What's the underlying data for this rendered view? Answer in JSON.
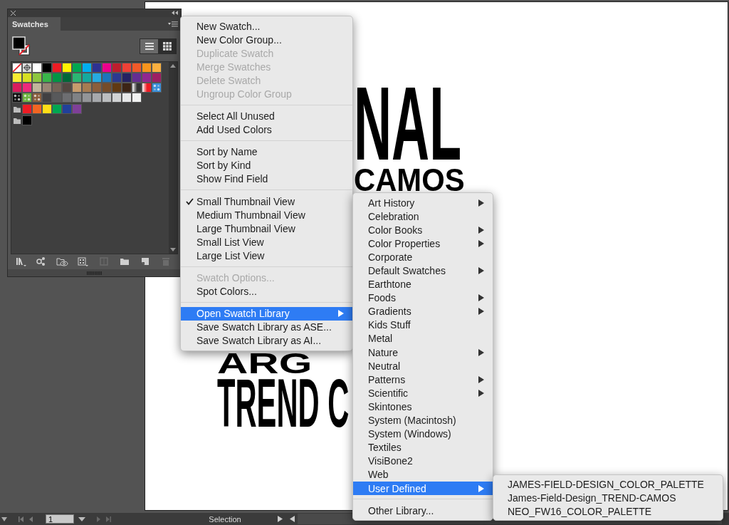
{
  "panel": {
    "title": "Swatches",
    "view_buttons": [
      {
        "kind": "list",
        "selected": false
      },
      {
        "kind": "grid",
        "selected": true
      }
    ],
    "swatch_rows": [
      {
        "items": [
          {
            "kind": "none"
          },
          {
            "kind": "registration"
          },
          {
            "kind": "color",
            "color": "#ffffff"
          },
          {
            "kind": "color",
            "color": "#000000"
          },
          {
            "kind": "color",
            "color": "#ed1c24"
          },
          {
            "kind": "color",
            "color": "#fff200"
          },
          {
            "kind": "color",
            "color": "#00a651"
          },
          {
            "kind": "color",
            "color": "#00aeef"
          },
          {
            "kind": "color",
            "color": "#2e3192"
          },
          {
            "kind": "color",
            "color": "#ec008c"
          },
          {
            "kind": "color",
            "color": "#be1e2d"
          },
          {
            "kind": "color",
            "color": "#ef4136"
          },
          {
            "kind": "color",
            "color": "#f15a29"
          },
          {
            "kind": "color",
            "color": "#f7941d"
          },
          {
            "kind": "color",
            "color": "#fbb040"
          }
        ]
      },
      {
        "items": [
          {
            "kind": "color",
            "color": "#f9ed32"
          },
          {
            "kind": "color",
            "color": "#d7df23"
          },
          {
            "kind": "color",
            "color": "#8dc63f"
          },
          {
            "kind": "color",
            "color": "#39b54a"
          },
          {
            "kind": "color",
            "color": "#009444"
          },
          {
            "kind": "color",
            "color": "#006838"
          },
          {
            "kind": "color",
            "color": "#2bb673"
          },
          {
            "kind": "color",
            "color": "#15a99e"
          },
          {
            "kind": "color",
            "color": "#27aae1"
          },
          {
            "kind": "color",
            "color": "#1c75bc"
          },
          {
            "kind": "color",
            "color": "#2b3990"
          },
          {
            "kind": "color",
            "color": "#262262"
          },
          {
            "kind": "color",
            "color": "#662d91"
          },
          {
            "kind": "color",
            "color": "#92278f"
          },
          {
            "kind": "color",
            "color": "#9e1f63"
          }
        ]
      },
      {
        "items": [
          {
            "kind": "color",
            "color": "#da1c5c"
          },
          {
            "kind": "color",
            "color": "#ee2a7b"
          },
          {
            "kind": "color",
            "color": "#c2b59b"
          },
          {
            "kind": "color",
            "color": "#998675"
          },
          {
            "kind": "color",
            "color": "#736357"
          },
          {
            "kind": "color",
            "color": "#534741"
          },
          {
            "kind": "color",
            "color": "#c69c6d"
          },
          {
            "kind": "color",
            "color": "#a67c52"
          },
          {
            "kind": "color",
            "color": "#8b5e3c"
          },
          {
            "kind": "color",
            "color": "#754c29"
          },
          {
            "kind": "color",
            "color": "#603913"
          },
          {
            "kind": "color",
            "color": "#3c2415"
          },
          {
            "kind": "gradient",
            "color": "#333333"
          },
          {
            "kind": "gradient",
            "color": "#ed1c24"
          },
          {
            "kind": "pattern",
            "color": "#3a8fd8"
          }
        ]
      },
      {
        "items": [
          {
            "kind": "pattern",
            "color": "#111111"
          },
          {
            "kind": "pattern",
            "color": "#6cb33f"
          },
          {
            "kind": "pattern",
            "color": "#8b5e3c"
          },
          {
            "kind": "color",
            "color": "#414042"
          },
          {
            "kind": "color",
            "color": "#58595b"
          },
          {
            "kind": "color",
            "color": "#6d6e71"
          },
          {
            "kind": "color",
            "color": "#808285"
          },
          {
            "kind": "color",
            "color": "#939598"
          },
          {
            "kind": "color",
            "color": "#a7a9ac"
          },
          {
            "kind": "color",
            "color": "#bcbec0"
          },
          {
            "kind": "color",
            "color": "#d1d3d4"
          },
          {
            "kind": "color",
            "color": "#e6e7e8"
          },
          {
            "kind": "color",
            "color": "#f1f2f2"
          }
        ]
      },
      {
        "items": [
          {
            "kind": "folder"
          },
          {
            "kind": "color",
            "color": "#ed1c24"
          },
          {
            "kind": "color",
            "color": "#f26522"
          },
          {
            "kind": "color",
            "color": "#ffde17"
          },
          {
            "kind": "color",
            "color": "#00a651"
          },
          {
            "kind": "color",
            "color": "#21409a"
          },
          {
            "kind": "color",
            "color": "#7f3f98"
          }
        ]
      },
      {
        "items": [
          {
            "kind": "folder"
          },
          {
            "kind": "color",
            "color": "#000000"
          }
        ]
      }
    ],
    "toolbar": [
      {
        "kind": "library",
        "disabled": false
      },
      {
        "kind": "links",
        "disabled": false
      },
      {
        "kind": "cloud",
        "disabled": false
      },
      {
        "kind": "options",
        "disabled": false
      },
      {
        "kind": "edit",
        "disabled": true
      },
      {
        "kind": "folder",
        "disabled": false
      },
      {
        "kind": "new",
        "disabled": false
      },
      {
        "kind": "trash",
        "disabled": true
      }
    ]
  },
  "artboard": {
    "lines": [
      "NAL",
      "CAMOS",
      "ARG",
      "TREND C"
    ]
  },
  "menu": {
    "groups": [
      [
        {
          "label": "New Swatch...",
          "disabled": false,
          "checked": false,
          "selected": false,
          "submenu": false
        },
        {
          "label": "New Color Group...",
          "disabled": false,
          "checked": false,
          "selected": false,
          "submenu": false
        },
        {
          "label": "Duplicate Swatch",
          "disabled": true,
          "checked": false,
          "selected": false,
          "submenu": false
        },
        {
          "label": "Merge Swatches",
          "disabled": true,
          "checked": false,
          "selected": false,
          "submenu": false
        },
        {
          "label": "Delete Swatch",
          "disabled": true,
          "checked": false,
          "selected": false,
          "submenu": false
        },
        {
          "label": "Ungroup Color Group",
          "disabled": true,
          "checked": false,
          "selected": false,
          "submenu": false
        }
      ],
      [
        {
          "label": "Select All Unused",
          "disabled": false,
          "checked": false,
          "selected": false,
          "submenu": false
        },
        {
          "label": "Add Used Colors",
          "disabled": false,
          "checked": false,
          "selected": false,
          "submenu": false
        }
      ],
      [
        {
          "label": "Sort by Name",
          "disabled": false,
          "checked": false,
          "selected": false,
          "submenu": false
        },
        {
          "label": "Sort by Kind",
          "disabled": false,
          "checked": false,
          "selected": false,
          "submenu": false
        },
        {
          "label": "Show Find Field",
          "disabled": false,
          "checked": false,
          "selected": false,
          "submenu": false
        }
      ],
      [
        {
          "label": "Small Thumbnail View",
          "disabled": false,
          "checked": true,
          "selected": false,
          "submenu": false
        },
        {
          "label": "Medium Thumbnail View",
          "disabled": false,
          "checked": false,
          "selected": false,
          "submenu": false
        },
        {
          "label": "Large Thumbnail View",
          "disabled": false,
          "checked": false,
          "selected": false,
          "submenu": false
        },
        {
          "label": "Small List View",
          "disabled": false,
          "checked": false,
          "selected": false,
          "submenu": false
        },
        {
          "label": "Large List View",
          "disabled": false,
          "checked": false,
          "selected": false,
          "submenu": false
        }
      ],
      [
        {
          "label": "Swatch Options...",
          "disabled": true,
          "checked": false,
          "selected": false,
          "submenu": false
        },
        {
          "label": "Spot Colors...",
          "disabled": false,
          "checked": false,
          "selected": false,
          "submenu": false
        }
      ],
      [
        {
          "label": "Open Swatch Library",
          "disabled": false,
          "checked": false,
          "selected": true,
          "submenu": true
        },
        {
          "label": "Save Swatch Library as ASE...",
          "disabled": false,
          "checked": false,
          "selected": false,
          "submenu": false
        },
        {
          "label": "Save Swatch Library as AI...",
          "disabled": false,
          "checked": false,
          "selected": false,
          "submenu": false
        }
      ]
    ]
  },
  "library_menu": {
    "groups": [
      [
        {
          "label": "Art History",
          "selected": false,
          "submenu": true
        },
        {
          "label": "Celebration",
          "selected": false,
          "submenu": false
        },
        {
          "label": "Color Books",
          "selected": false,
          "submenu": true
        },
        {
          "label": "Color Properties",
          "selected": false,
          "submenu": true
        },
        {
          "label": "Corporate",
          "selected": false,
          "submenu": false
        },
        {
          "label": "Default Swatches",
          "selected": false,
          "submenu": true
        },
        {
          "label": "Earthtone",
          "selected": false,
          "submenu": false
        },
        {
          "label": "Foods",
          "selected": false,
          "submenu": true
        },
        {
          "label": "Gradients",
          "selected": false,
          "submenu": true
        },
        {
          "label": "Kids Stuff",
          "selected": false,
          "submenu": false
        },
        {
          "label": "Metal",
          "selected": false,
          "submenu": false
        },
        {
          "label": "Nature",
          "selected": false,
          "submenu": true
        },
        {
          "label": "Neutral",
          "selected": false,
          "submenu": false
        },
        {
          "label": "Patterns",
          "selected": false,
          "submenu": true
        },
        {
          "label": "Scientific",
          "selected": false,
          "submenu": true
        },
        {
          "label": "Skintones",
          "selected": false,
          "submenu": false
        },
        {
          "label": "System (Macintosh)",
          "selected": false,
          "submenu": false
        },
        {
          "label": "System (Windows)",
          "selected": false,
          "submenu": false
        },
        {
          "label": "Textiles",
          "selected": false,
          "submenu": false
        },
        {
          "label": "VisiBone2",
          "selected": false,
          "submenu": false
        },
        {
          "label": "Web",
          "selected": false,
          "submenu": false
        },
        {
          "label": "User Defined",
          "selected": true,
          "submenu": true
        }
      ],
      [
        {
          "label": "Other Library...",
          "selected": false,
          "submenu": false
        }
      ]
    ]
  },
  "user_menu": {
    "items": [
      "JAMES-FIELD-DESIGN_COLOR_PALETTE",
      "James-Field-Design_TREND-CAMOS",
      "NEO_FW16_COLOR_PALETTE"
    ]
  },
  "status_bar": {
    "page": "1",
    "tool": "Selection"
  }
}
